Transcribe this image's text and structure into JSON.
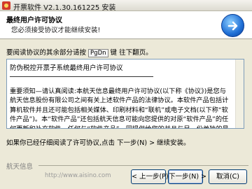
{
  "window": {
    "title": "开票软件 V2.1.30.161225 安装"
  },
  "header": {
    "title": "最终用户许可协议",
    "subtitle": "您必须接受协议才能继续安装!"
  },
  "instruction": {
    "prefix": "要阅读协议的其余部分请按",
    "key": "PgDn",
    "suffix": "键 往下翻页。"
  },
  "license": {
    "line1": "防伪税控开票子系统最终用户许可协议",
    "paragraph": "重要须知—请认真阅读:本航天信息最终用户许可协议(以下称《协议》)是您与航天信息股份有限公司之间有关上述软件产品的法律协议。本软件产品包括计算机软件并且还可能包括相关媒体、印刷材料和“联机”或电子文档(以下称“软件产品”)。本“软件产品”还包括航天信息可能向您提供的对原“软件产品”的任何更新和补充软件。任何与“软件产品”一同提供给您的并且与另一份单独的最终用户许可协议相关联的软件产品将根据该许可协议的条款授权予您。"
  },
  "accept_text": "如果你已经仔细阅读了许可协议,点击 下一步(N) > 继续安装。",
  "footer": {
    "brand": "航天信息",
    "watermark": "http://www.aisino.com"
  },
  "buttons": {
    "prev": "< 上一步(P)",
    "next": "下一步(N) >",
    "cancel": "取消(C)"
  }
}
